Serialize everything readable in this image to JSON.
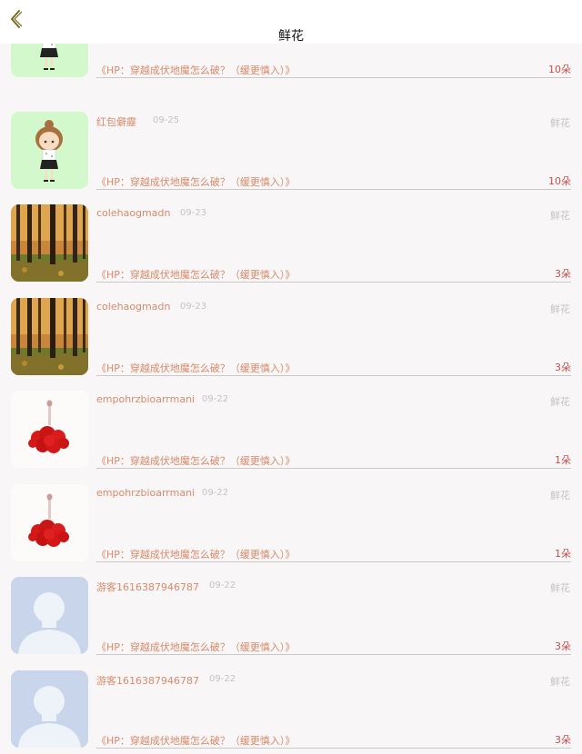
{
  "header": {
    "title": "鲜花"
  },
  "items": [
    {
      "name": "",
      "date": "",
      "type": "",
      "book": "《HP：穿越成伏地魔怎么破？（缓更慎入）》",
      "count": "10朵",
      "avatar": "cartoon-girl"
    },
    {
      "name": "红包僻靂",
      "date": "09-25",
      "type": "鲜花",
      "book": "《HP：穿越成伏地魔怎么破？（缓更慎入）》",
      "count": "10朵",
      "avatar": "cartoon-girl"
    },
    {
      "name": "colehaogmadn",
      "date": "09-23",
      "type": "鲜花",
      "book": "《HP：穿越成伏地魔怎么破？（缓更慎入）》",
      "count": "3朵",
      "avatar": "forest"
    },
    {
      "name": "colehaogmadn",
      "date": "09-23",
      "type": "鲜花",
      "book": "《HP：穿越成伏地魔怎么破？（缓更慎入）》",
      "count": "3朵",
      "avatar": "forest"
    },
    {
      "name": "empohrzbioarrmani",
      "date": "09-22",
      "type": "鲜花",
      "book": "《HP：穿越成伏地魔怎么破？（缓更慎入）》",
      "count": "1朵",
      "avatar": "red-dress"
    },
    {
      "name": "empohrzbioarrmani",
      "date": "09-22",
      "type": "鲜花",
      "book": "《HP：穿越成伏地魔怎么破？（缓更慎入）》",
      "count": "1朵",
      "avatar": "red-dress"
    },
    {
      "name": "游客1616387946787",
      "date": "09-22",
      "type": "鲜花",
      "book": "《HP：穿越成伏地魔怎么破？（缓更慎入）》",
      "count": "3朵",
      "avatar": "default-user"
    },
    {
      "name": "游客1616387946787",
      "date": "09-22",
      "type": "鲜花",
      "book": "《HP：穿越成伏地魔怎么破？（缓更慎入）》",
      "count": "3朵",
      "avatar": "default-user"
    }
  ]
}
